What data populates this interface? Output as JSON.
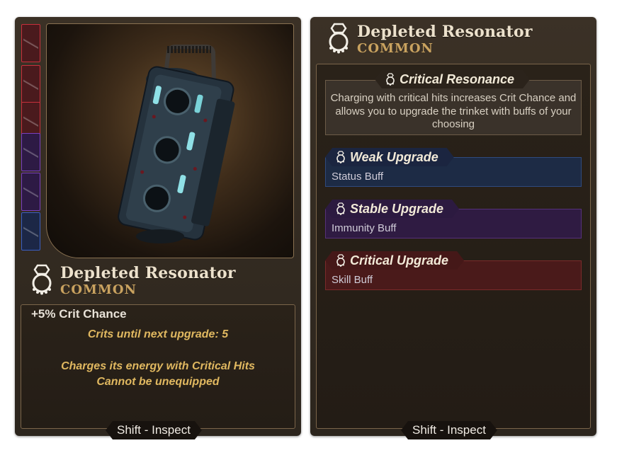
{
  "left_card": {
    "item_name": "Depleted Resonator",
    "rarity": "COMMON",
    "stat_line": "+5% Crit Chance",
    "upgrade_counter": "Crits until next upgrade: 5",
    "description_line1": "Charges its energy with Critical Hits",
    "description_line2": "Cannot be unequipped",
    "shift_hint": "Shift - Inspect",
    "rarity_strip": [
      "red",
      "red",
      "red",
      "purple",
      "purple",
      "blue"
    ]
  },
  "right_card": {
    "item_name": "Depleted Resonator",
    "rarity": "COMMON",
    "sections": {
      "resonance": {
        "title": "Critical Resonance",
        "description": "Charging with critical hits increases Crit Chance and allows you to upgrade the trinket with buffs of your choosing"
      },
      "weak": {
        "title": "Weak Upgrade",
        "subtitle": "Status Buff"
      },
      "stable": {
        "title": "Stable Upgrade",
        "subtitle": "Immunity Buff"
      },
      "critical": {
        "title": "Critical Upgrade",
        "subtitle": "Skill Buff"
      }
    },
    "shift_hint": "Shift - Inspect"
  },
  "colors": {
    "rarity_gold": "#c9a25f",
    "description_gold": "#e0b860",
    "weak_blue": "#1d2b45",
    "stable_purple": "#2f1b42",
    "critical_red": "#4a1a1a"
  },
  "icons": {
    "trinket": "ring-trinket-icon"
  }
}
